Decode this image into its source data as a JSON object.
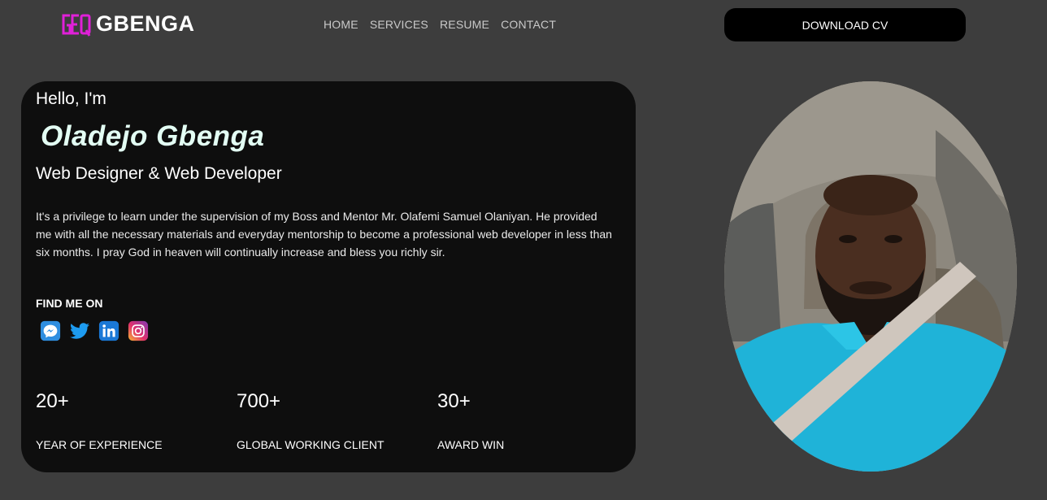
{
  "header": {
    "logo_text": "GBENGA",
    "nav": [
      "HOME",
      "SERVICES",
      "RESUME",
      "CONTACT"
    ],
    "download_label": "DOWNLOAD CV"
  },
  "hero": {
    "greeting": "Hello, I'm",
    "name": "Oladejo Gbenga",
    "role": "Web Designer & Web Developer",
    "bio": "It's a privilege to learn under the supervision of my Boss and Mentor Mr. Olafemi Samuel Olaniyan. He provided me with all the necessary materials and everyday mentorship to become a professional web developer in less than six months. I pray God in heaven will continually increase and bless you richly sir.",
    "find_me_title": "FIND ME ON",
    "socials": [
      {
        "name": "messenger-icon"
      },
      {
        "name": "twitter-icon"
      },
      {
        "name": "linkedin-icon"
      },
      {
        "name": "instagram-icon"
      }
    ],
    "stats": [
      {
        "value": "20+",
        "label": "YEAR OF EXPERIENCE"
      },
      {
        "value": "700+",
        "label": "GLOBAL WORKING CLIENT"
      },
      {
        "value": "30+",
        "label": "AWARD WIN"
      }
    ]
  },
  "colors": {
    "background": "#3d3d3d",
    "card": "#0e0e0e",
    "logo_accent": "#e020d8",
    "name_color": "#e3fff4"
  }
}
